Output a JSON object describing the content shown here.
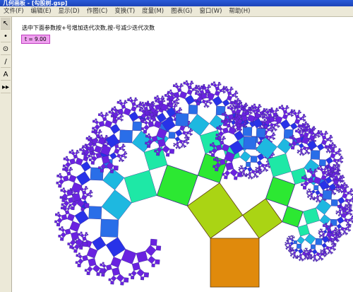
{
  "window": {
    "title": "几何画板 - [勾股树.gsp]"
  },
  "menu": [
    {
      "label": "文件(F)"
    },
    {
      "label": "编辑(E)"
    },
    {
      "label": "显示(D)"
    },
    {
      "label": "作图(C)"
    },
    {
      "label": "变换(T)"
    },
    {
      "label": "度量(M)"
    },
    {
      "label": "图表(G)"
    },
    {
      "label": "窗口(W)"
    },
    {
      "label": "帮助(H)"
    }
  ],
  "toolbox": [
    {
      "name": "select-arrow-tool",
      "glyph": "↖"
    },
    {
      "name": "point-tool",
      "glyph": "•"
    },
    {
      "name": "compass-tool",
      "glyph": "⊙"
    },
    {
      "name": "line-tool",
      "glyph": "/"
    },
    {
      "name": "text-tool",
      "glyph": "A"
    },
    {
      "name": "custom-tool",
      "glyph": "▸▸"
    }
  ],
  "canvas": {
    "instruction": "选中下面参数按+号增加迭代次数,按-号减少迭代次数",
    "parameter_label": "t = 9.00"
  },
  "colors": {
    "trunk": "#e08a0c",
    "level1": "#aad414",
    "level2": "#2ce832",
    "level3": "#1ee8a6",
    "level4": "#1eb8e0",
    "level5": "#2a6ee8",
    "level6": "#2832e8",
    "deep": "#6a22e0",
    "outline": "#5a3a10"
  }
}
